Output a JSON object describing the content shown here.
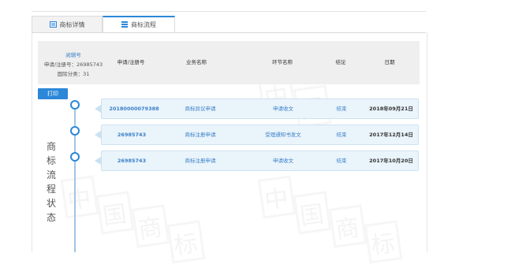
{
  "tabs": [
    {
      "label": "商标详情",
      "icon": "document-icon",
      "active": false
    },
    {
      "label": "商标流程",
      "icon": "list-icon",
      "active": true
    }
  ],
  "header": {
    "lang_link": "阅辑号",
    "reg_info": "申请/注册号：26985743",
    "class_info": "国际分类：31",
    "columns": [
      "申请/注册号",
      "业务名称",
      "环节名称",
      "结论",
      "日期"
    ]
  },
  "print_label": "打印",
  "side_title": [
    "商",
    "标",
    "流",
    "程",
    "状",
    "态"
  ],
  "rows": [
    {
      "reg_no": "20180000079388",
      "business": "商标异议申请",
      "step": "申请收文",
      "result": "结束",
      "date": "2018年09月21日"
    },
    {
      "reg_no": "26985743",
      "business": "商标注册申请",
      "step": "受理通知书发文",
      "result": "结束",
      "date": "2017年12月14日"
    },
    {
      "reg_no": "26985743",
      "business": "商标注册申请",
      "step": "申请收文",
      "result": "结束",
      "date": "2017年10月20日"
    }
  ],
  "colors": {
    "accent": "#2b87d8",
    "row_bg": "#eaf4fb",
    "link": "#3a80c8"
  }
}
